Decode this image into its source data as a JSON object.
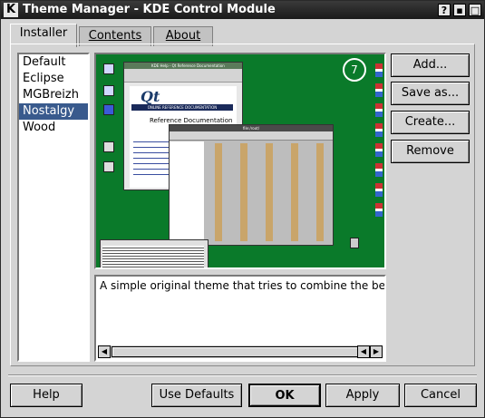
{
  "window": {
    "title": "Theme Manager - KDE Control Module",
    "icon": "k-icon"
  },
  "titlebar_buttons": [
    "?",
    "▪",
    "□",
    "✕"
  ],
  "tabs": [
    {
      "label": "Installer",
      "active": true
    },
    {
      "label": "Contents",
      "active": false
    },
    {
      "label": "About",
      "active": false
    }
  ],
  "themes": [
    {
      "name": "Default",
      "selected": false
    },
    {
      "name": "Eclipse",
      "selected": false
    },
    {
      "name": "MGBreizh",
      "selected": false
    },
    {
      "name": "Nostalgy",
      "selected": true
    },
    {
      "name": "Wood",
      "selected": false
    }
  ],
  "side_buttons": {
    "add": "Add...",
    "save_as": "Save as...",
    "create": "Create...",
    "remove": "Remove"
  },
  "description": "A simple original theme that tries to combine the best asp",
  "preview": {
    "desktop_color": "#0a7a2a",
    "qt_window_title": "KDE Help - Qt Reference Documentation",
    "qt_logo": "Qt",
    "qt_banner": "ONLINE REFERENCE DOCUMENTATION",
    "qt_heading": "Reference Documentation",
    "filemgr_title": "file:/root/",
    "clock": "7"
  },
  "bottom_buttons": {
    "help": "Help",
    "use_defaults": "Use Defaults",
    "ok": "OK",
    "apply": "Apply",
    "cancel": "Cancel"
  }
}
